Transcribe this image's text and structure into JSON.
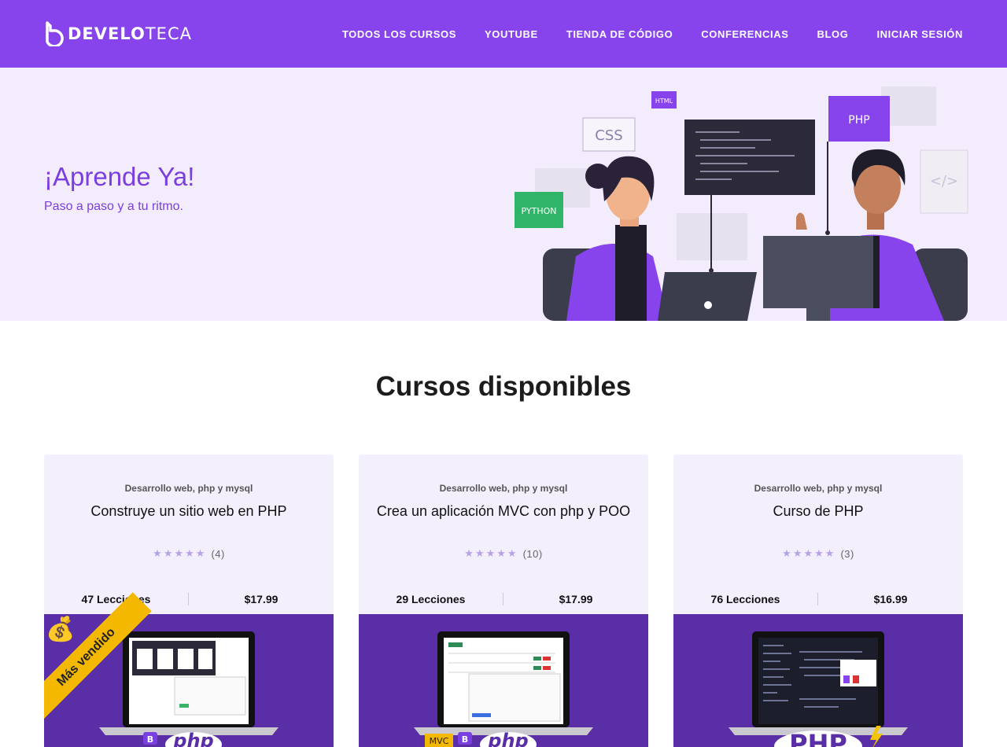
{
  "header": {
    "logo_bold": "DEVELO",
    "logo_light": "TECA",
    "nav": [
      {
        "label": "TODOS LOS CURSOS"
      },
      {
        "label": "YOUTUBE"
      },
      {
        "label": "TIENDA DE CÓDIGO"
      },
      {
        "label": "CONFERENCIAS"
      },
      {
        "label": "BLOG"
      },
      {
        "label": "INICIAR SESIÓN"
      }
    ]
  },
  "hero": {
    "title": "¡Aprende Ya!",
    "subtitle": "Paso a paso y a tu ritmo.",
    "tags": {
      "css": "CSS",
      "html": "HTML",
      "php": "PHP",
      "python": "PYTHON"
    }
  },
  "section": {
    "title": "Cursos disponibles"
  },
  "courses": [
    {
      "category": "Desarrollo web, php y mysql",
      "title": "Construye un sitio web en PHP",
      "rating_count": "(4)",
      "lessons": "47 Lecciones",
      "price": "$17.99",
      "badge": "Más vendido"
    },
    {
      "category": "Desarrollo web, php y mysql",
      "title": "Crea un aplicación MVC con php y POO",
      "rating_count": "(10)",
      "lessons": "29 Lecciones",
      "price": "$17.99",
      "badge_tags": [
        "MVC",
        "B"
      ]
    },
    {
      "category": "Desarrollo web, php y mysql",
      "title": "Curso de PHP",
      "rating_count": "(3)",
      "lessons": "76 Lecciones",
      "price": "$16.99"
    }
  ],
  "colors": {
    "brand": "#8743ec",
    "hero_bg": "#f2ecfd",
    "card_bg": "#f4effd",
    "card_img_bg": "#5a2ea6",
    "badge": "#f5b800"
  }
}
